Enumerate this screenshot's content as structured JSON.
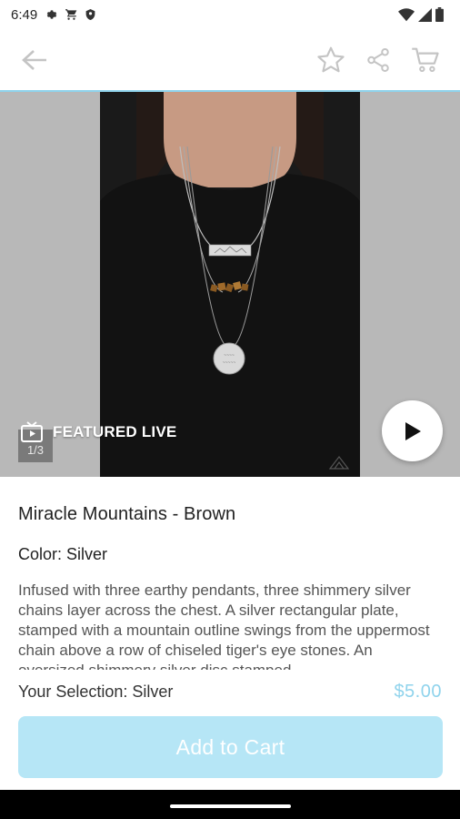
{
  "status_bar": {
    "time": "6:49",
    "left_icons": [
      "gear-icon",
      "cart-icon",
      "shield-icon"
    ],
    "right_icons": [
      "wifi-icon",
      "signal-icon",
      "battery-icon"
    ]
  },
  "app_bar": {
    "back_icon": "back-arrow-icon",
    "actions": [
      "star-icon",
      "share-icon",
      "cart-icon"
    ]
  },
  "media": {
    "featured_label": "FEATURED LIVE",
    "page_indicator": "1/3",
    "play_icon": "play-icon"
  },
  "product": {
    "title": "Miracle Mountains - Brown",
    "color": "Color: Silver",
    "description": "Infused with three earthy pendants, three shimmery silver chains layer across the chest. A silver rectangular plate, stamped with a mountain outline swings from the uppermost chain above a row of chiseled tiger's eye stones. An oversized shimmery silver disc stamped"
  },
  "footer": {
    "selection": "Your Selection: Silver",
    "price": "$5.00",
    "add_to_cart": "Add to Cart"
  },
  "colors": {
    "accent": "#8fd3ec",
    "button_bg": "#b6e6f6"
  }
}
